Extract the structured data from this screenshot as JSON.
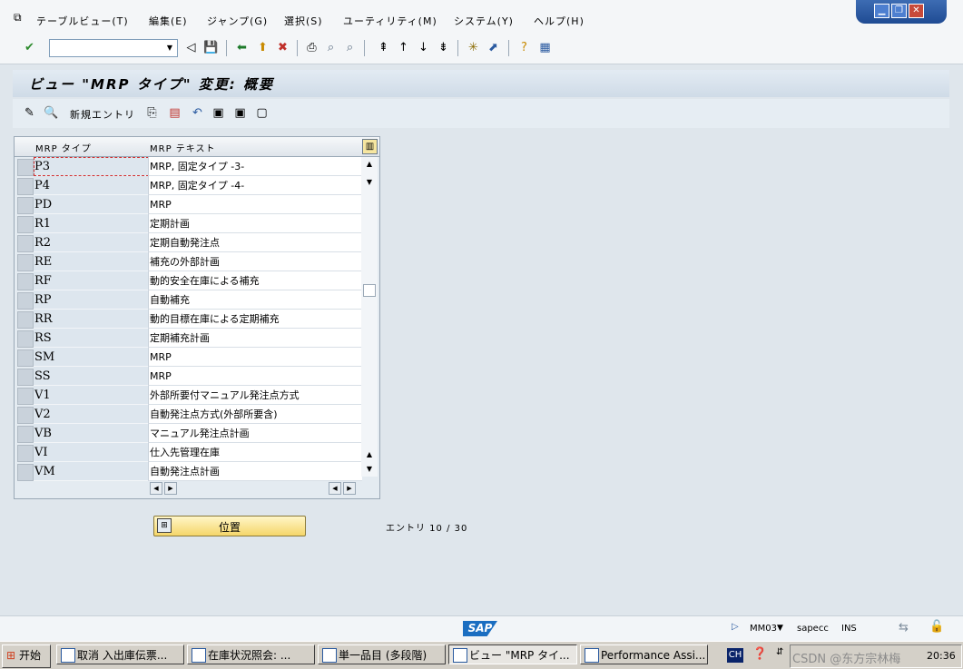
{
  "menu": {
    "items": [
      "テーブルビュー(T)",
      "編集(E)",
      "ジャンプ(G)",
      "選択(S)",
      "ユーティリティ(M)",
      "システム(Y)",
      "ヘルプ(H)"
    ]
  },
  "window_controls": {
    "minimize": "▁",
    "restore": "❐",
    "close": "✕"
  },
  "screen": {
    "title": "ビュー \"MRP タイプ\" 変更: 概要"
  },
  "app_toolbar": {
    "new_entries": "新規エントリ"
  },
  "table": {
    "columns": [
      "MRP タイプ",
      "MRP テキスト"
    ],
    "rows": [
      {
        "type": "P3",
        "text": "MRP, 固定タイプ -3-"
      },
      {
        "type": "P4",
        "text": "MRP, 固定タイプ -4-"
      },
      {
        "type": "PD",
        "text": "MRP"
      },
      {
        "type": "R1",
        "text": "定期計画"
      },
      {
        "type": "R2",
        "text": "定期自動発注点"
      },
      {
        "type": "RE",
        "text": "補充の外部計画"
      },
      {
        "type": "RF",
        "text": "動的安全在庫による補充"
      },
      {
        "type": "RP",
        "text": "自動補充"
      },
      {
        "type": "RR",
        "text": "動的目標在庫による定期補充"
      },
      {
        "type": "RS",
        "text": "定期補充計画"
      },
      {
        "type": "SM",
        "text": "MRP"
      },
      {
        "type": "SS",
        "text": "MRP"
      },
      {
        "type": "V1",
        "text": "外部所要付マニュアル発注点方式"
      },
      {
        "type": "V2",
        "text": "自動発注点方式(外部所要含)"
      },
      {
        "type": "VB",
        "text": "マニュアル発注点計画"
      },
      {
        "type": "VI",
        "text": "仕入先管理在庫"
      },
      {
        "type": "VM",
        "text": "自動発注点計画"
      }
    ]
  },
  "position_button": {
    "label": "位置"
  },
  "entries": {
    "text": "エントリ 10 / 30"
  },
  "status": {
    "transaction": "MM03",
    "system": "sapecc",
    "mode": "INS",
    "logo": "SAP"
  },
  "taskbar": {
    "start": "开始",
    "tasks": [
      "取消 入出庫伝票...",
      "在庫状況照会: ...",
      "単一品目 (多段階)",
      "ビュー \"MRP タイ...",
      "Performance Assi..."
    ],
    "lang": "CH",
    "watermark": "CSDN @东方宗林梅",
    "time": "20:36"
  }
}
